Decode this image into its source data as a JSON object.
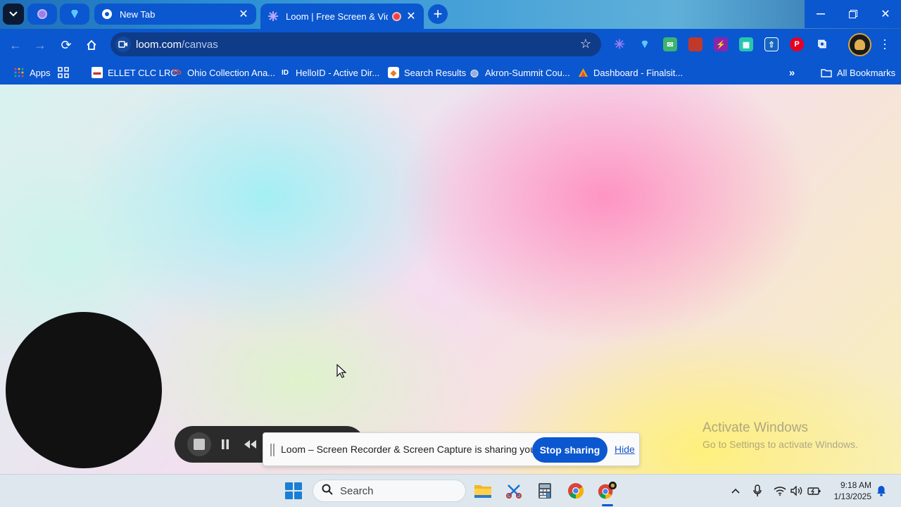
{
  "browser": {
    "tabs": [
      {
        "title": "New Tab",
        "icon": "chrome-icon"
      },
      {
        "title": "Loom | Free Screen & Video Recording Software",
        "icon": "loom-icon",
        "recording": true
      }
    ],
    "address": {
      "host": "loom.com",
      "path": "/canvas"
    },
    "bookmarks": [
      {
        "label": "Apps",
        "icon": "apps-grid-icon"
      },
      {
        "label": "ELLET CLC LRC",
        "icon": "building-icon"
      },
      {
        "label": "Ohio Collection Ana...",
        "icon": "tb-icon"
      },
      {
        "label": "HelloID - Active Dir...",
        "icon": "id-icon"
      },
      {
        "label": "Search Results",
        "icon": "shield-icon"
      },
      {
        "label": "Akron-Summit Cou...",
        "icon": "globe-icon"
      },
      {
        "label": "Dashboard - Finalsit...",
        "icon": "triangle-icon"
      }
    ],
    "all_bookmarks_label": "All Bookmarks",
    "colors": {
      "frame": "#0b57d0",
      "omnibox": "#0f3c89"
    }
  },
  "loom": {
    "share_message": "Loom – Screen Recorder & Screen Capture is sharing your screen.",
    "stop_sharing_label": "Stop sharing",
    "hide_label": "Hide"
  },
  "watermark": {
    "title": "Activate Windows",
    "subtitle": "Go to Settings to activate Windows."
  },
  "taskbar": {
    "search_placeholder": "Search",
    "time": "9:18 AM",
    "date": "1/13/2025"
  }
}
